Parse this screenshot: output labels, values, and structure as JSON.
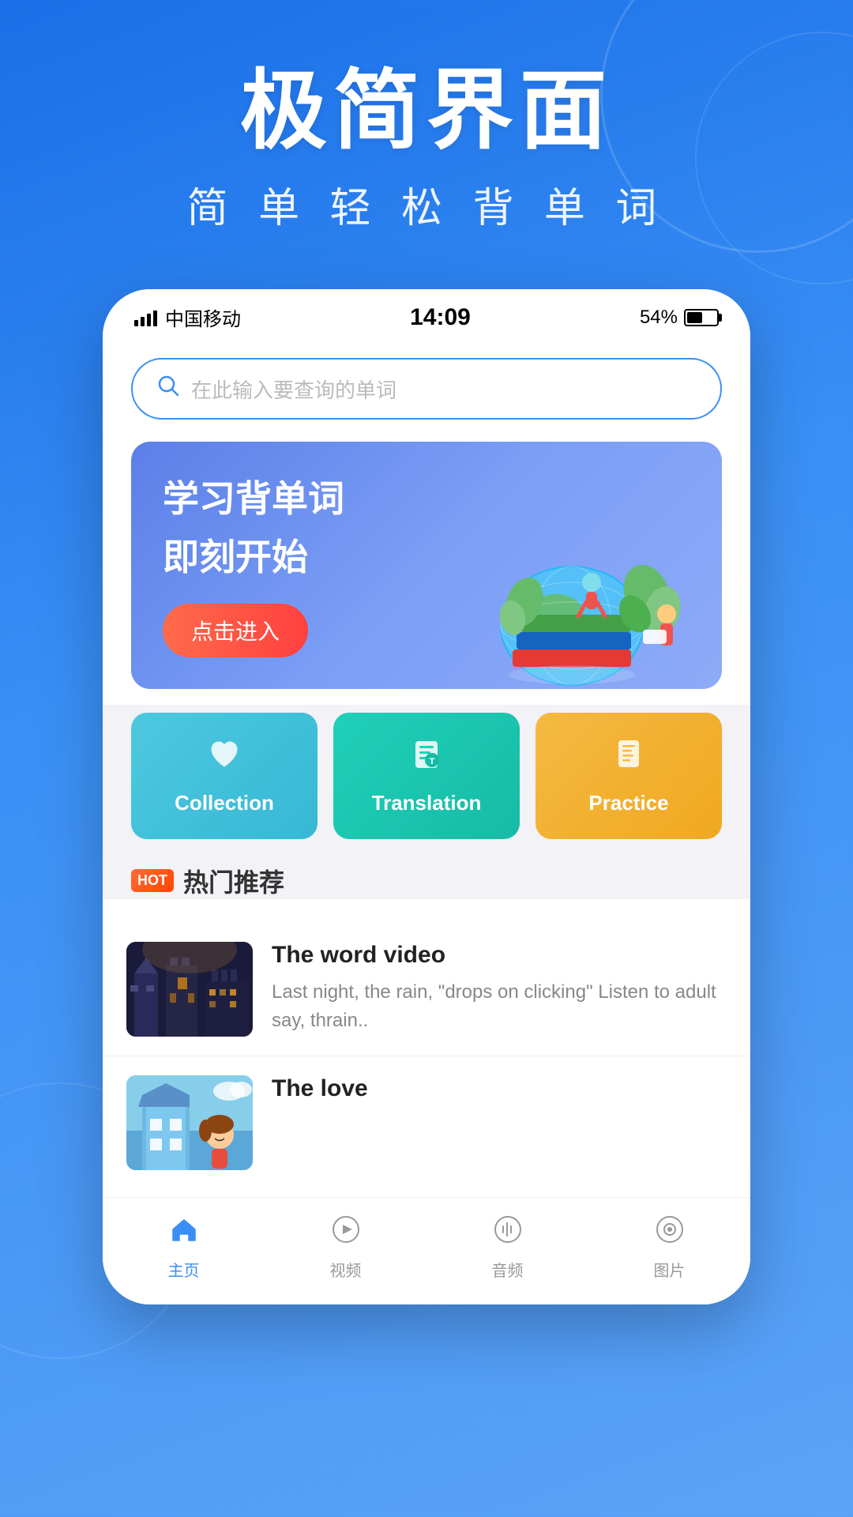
{
  "background": {
    "gradient_start": "#1a6fe8",
    "gradient_end": "#5ba3f7"
  },
  "header": {
    "main_title": "极简界面",
    "sub_title": "简 单 轻 松 背 单 词"
  },
  "status_bar": {
    "carrier": "中国移动",
    "time": "14:09",
    "battery": "54%"
  },
  "search": {
    "placeholder": "在此输入要查询的单词"
  },
  "banner": {
    "title_line1": "学习背单词",
    "title_line2": "即刻开始",
    "button_label": "点击进入"
  },
  "feature_cards": [
    {
      "id": "collection",
      "label": "Collection",
      "icon": "♡",
      "color_class": "collection"
    },
    {
      "id": "translation",
      "label": "Translation",
      "icon": "📋",
      "color_class": "translation"
    },
    {
      "id": "practice",
      "label": "Practice",
      "icon": "📄",
      "color_class": "practice"
    }
  ],
  "hot_section": {
    "badge": "HOT",
    "title": "热门推荐"
  },
  "content_items": [
    {
      "id": "item1",
      "title": "The word video",
      "description": "Last night, the rain, \"drops on clicking\"\nListen to adult say, thrain.."
    },
    {
      "id": "item2",
      "title": "The love",
      "description": ""
    }
  ],
  "bottom_nav": [
    {
      "id": "home",
      "label": "主页",
      "icon": "🏠",
      "active": true
    },
    {
      "id": "video",
      "label": "视频",
      "icon": "▶",
      "active": false
    },
    {
      "id": "audio",
      "label": "音频",
      "icon": "🔊",
      "active": false
    },
    {
      "id": "photo",
      "label": "图片",
      "icon": "📷",
      "active": false
    }
  ]
}
